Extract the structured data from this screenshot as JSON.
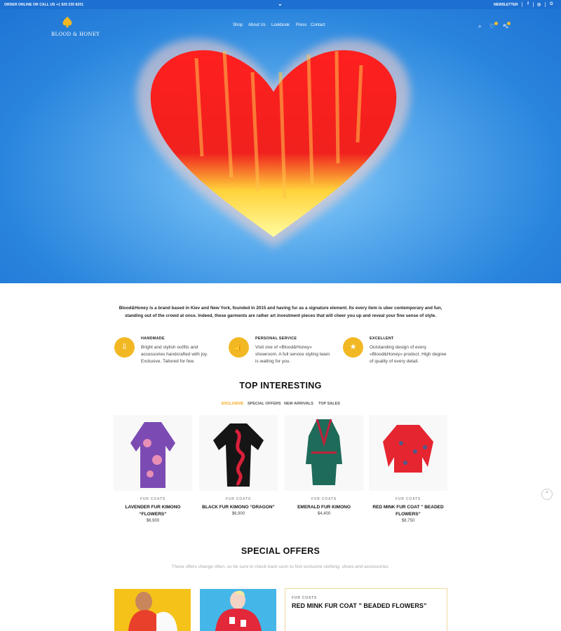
{
  "topbar": {
    "order_text": "ORDER ONLINE OR CALL US +1 929 235 8201",
    "newsletter": "NEWSLETTER",
    "social": [
      "f",
      "◎",
      "G"
    ]
  },
  "header": {
    "logo_text": "BLOOD & HONEY",
    "nav": [
      "Shop",
      "About Us",
      "Lookbook",
      "Press",
      "Contact"
    ],
    "wishlist_count": "0",
    "cart_count": "0"
  },
  "intro": {
    "text": "Blood&Honey is a brand based in Kiev and New York, founded in 2015 and having fur as a signature element. Its every item is uber contemporary and fun, standing out of the crowd at once. Indeed, these garments are rather art investment pieces that will cheer you up and reveal your fine sense of style."
  },
  "features": [
    {
      "title": "HANDMADE",
      "desc": "Bright and stylish outfits and accessories handcrafted with joy. Exclusive. Tailored for few.",
      "icon": "hand-icon"
    },
    {
      "title": "PERSONAL SERVICE",
      "desc": "Visit one of «Blood&Honey» showroom. A full service styling team is waiting for you.",
      "icon": "thumbs-up-icon"
    },
    {
      "title": "EXCELLENT",
      "desc": "Outstanding design of every «Blood&Honey» product. High degree of quality of every detail.",
      "icon": "star-icon"
    }
  ],
  "top_interesting": {
    "title": "TOP INTERESTING",
    "tabs": [
      "EXCLUSIVE",
      "SPECIAL OFFERS",
      "NEW ARRIVALS",
      "TOP SALES"
    ],
    "products": [
      {
        "category": "FUR COATS",
        "name": "LAVENDER FUR KIMONO “FLOWERS”",
        "price": "$6,900",
        "color": "#7b4bb3",
        "accent": "#e98fb6"
      },
      {
        "category": "FUR COATS",
        "name": "BLACK FUR KIMONO “DRAGON”",
        "price": "$6,900",
        "color": "#151515",
        "accent": "#d8203a"
      },
      {
        "category": "FUR COATS",
        "name": "EMERALD FUR KIMONO",
        "price": "$4,400",
        "color": "#1f6b5a",
        "accent": "#c0213a"
      },
      {
        "category": "FUR COATS",
        "name": "RED MINK FUR COAT ” BEADED FLOWERS”",
        "price": "$8,750",
        "color": "#e52530",
        "accent": "#4e5a8a"
      }
    ]
  },
  "special_offers": {
    "title": "SPECIAL OFFERS",
    "subtitle": "These offers change often, so be sure to check back soon to find exclusive clothing, shoes and accessories.",
    "card": {
      "category": "FUR COATS",
      "name": "RED MINK FUR COAT ” BEADED FLOWERS”"
    }
  },
  "colors": {
    "accent": "#f2b824",
    "topbar": "#1d6fd1"
  }
}
